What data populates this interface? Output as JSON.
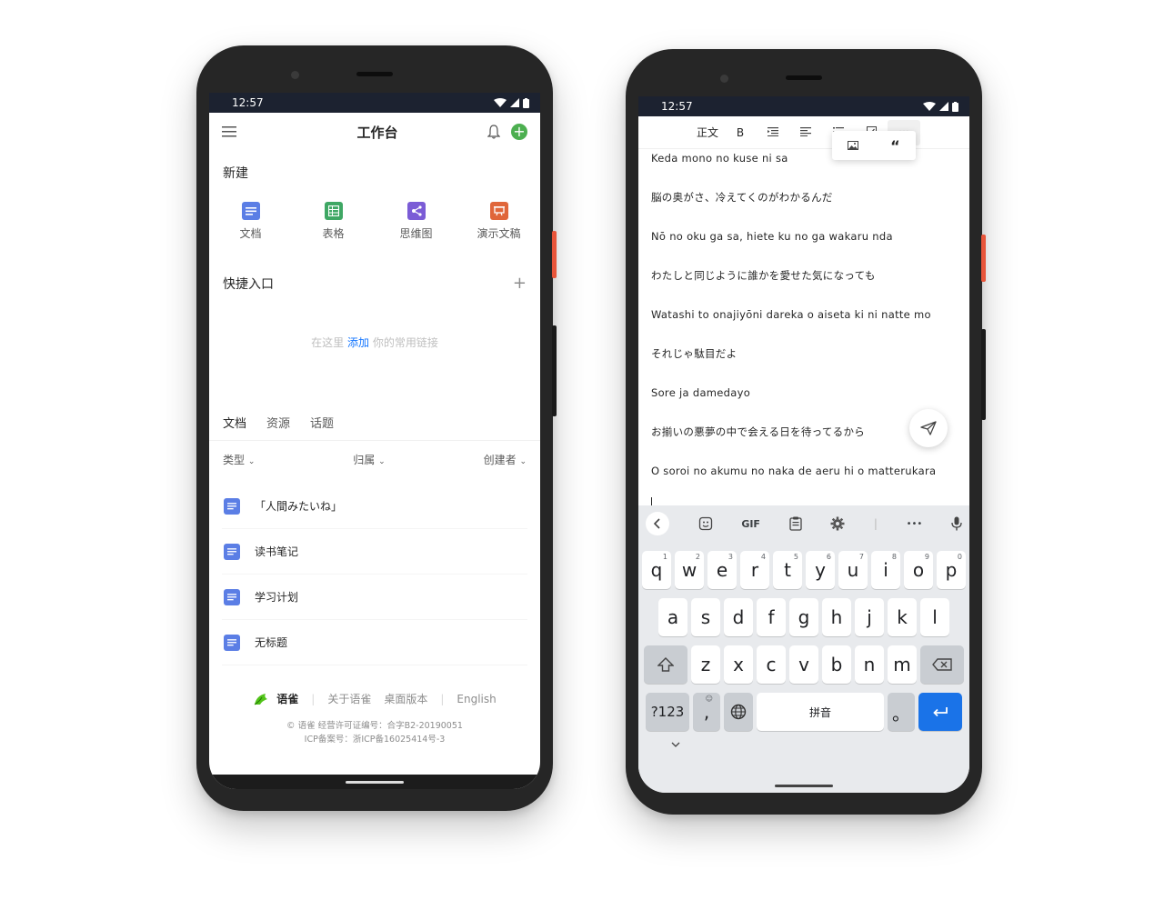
{
  "left": {
    "status_time": "12:57",
    "header_title": "工作台",
    "new_section": "新建",
    "new_items": [
      {
        "label": "文档",
        "color": "#5b7ee5"
      },
      {
        "label": "表格",
        "color": "#3fa764"
      },
      {
        "label": "思维图",
        "color": "#7b5cd6"
      },
      {
        "label": "演示文稿",
        "color": "#e0663a"
      }
    ],
    "quick_title": "快捷入口",
    "quick_add": "+",
    "empty_prefix": "在这里 ",
    "empty_link": "添加",
    "empty_suffix": " 你的常用链接",
    "tabs": [
      "文档",
      "资源",
      "话题"
    ],
    "filters": [
      "类型",
      "归属",
      "创建者"
    ],
    "docs": [
      "「人間みたいね」",
      "读书笔记",
      "学习计划",
      "无标题"
    ],
    "footer": {
      "brand": "语雀",
      "about": "关于语雀",
      "desktop": "桌面版本",
      "english": "English",
      "legal1": "© 语雀  经营许可证编号：合字B2-20190051",
      "legal2": "ICP备案号：浙ICP备16025414号-3"
    },
    "accent_green": "#4caf50"
  },
  "right": {
    "status_time": "12:57",
    "toolbar": {
      "body": "正文",
      "bold": "B",
      "more": "···"
    },
    "popover_quote": "“",
    "lines": [
      "Keda mono no kuse ni sa",
      "脳の奥がさ、冷えてくのがわかるんだ",
      "Nō no oku ga sa, hiete ku no ga wakaru nda",
      "わたしと同じように誰かを愛せた気になっても",
      "Watashi to onajiyōni dareka o aiseta ki ni natte mo",
      "それじゃ駄目だよ",
      "Sore ja damedayo",
      "お揃いの悪夢の中で会える日を待ってるから",
      "O soroi no akumu no naka de aeru hi o matterukara"
    ],
    "keyboard": {
      "gif": "GIF",
      "more": "•••",
      "row1": [
        "q",
        "w",
        "e",
        "r",
        "t",
        "y",
        "u",
        "i",
        "o",
        "p"
      ],
      "row1_hints": [
        "1",
        "2",
        "3",
        "4",
        "5",
        "6",
        "7",
        "8",
        "9",
        "0"
      ],
      "row2": [
        "a",
        "s",
        "d",
        "f",
        "g",
        "h",
        "j",
        "k",
        "l"
      ],
      "row3": [
        "z",
        "x",
        "c",
        "v",
        "b",
        "n",
        "m"
      ],
      "symbols": "?123",
      "comma": ",",
      "space": "拼音",
      "period": "。",
      "accent_blue": "#1a73e8"
    }
  }
}
